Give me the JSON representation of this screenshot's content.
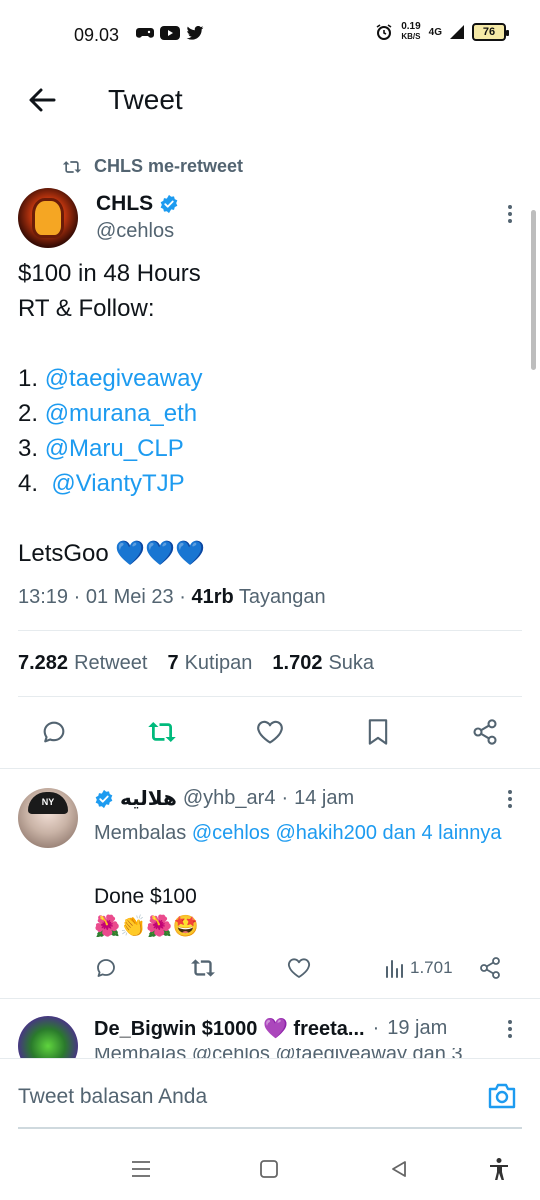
{
  "status_bar": {
    "time": "09.03",
    "speed_value": "0.19",
    "speed_unit": "KB/S",
    "network": "4G",
    "battery": "76"
  },
  "header": {
    "title": "Tweet"
  },
  "tweet": {
    "retweet_context": "CHLS me-retweet",
    "author_name": "CHLS",
    "author_handle": "@cehlos",
    "lines": {
      "l1": "$100 in 48 Hours",
      "l2": "RT & Follow:",
      "n1": "1. ",
      "m1": "@taegiveaway",
      "n2": "2. ",
      "m2": "@murana_eth",
      "n3": "3. ",
      "m3": "@Maru_CLP",
      "n4": "4.  ",
      "m4": "@ViantyTJP",
      "l7": "LetsGoo 💙💙💙"
    },
    "time": "13:19",
    "date": "01 Mei 23",
    "views_count": "41rb",
    "views_label": "Tayangan",
    "stats": {
      "retweet_count": "7.282",
      "retweet_label": "Retweet",
      "quote_count": "7",
      "quote_label": "Kutipan",
      "like_count": "1.702",
      "like_label": "Suka"
    }
  },
  "replies": [
    {
      "name": "هلاليه",
      "handle": "@yhb_ar4",
      "time": "14 jam",
      "replying_prefix": "Membalas ",
      "replying_mentions": "@cehlos @hakih200 dan 4 lainnya",
      "text_line1": "Done $100",
      "text_line2": "🌺👏🌺🤩",
      "views": "1.701"
    },
    {
      "name": "De_Bigwin $1000 💜 freeta...",
      "time": "19 jam",
      "replying_clip": "Membalas @cehlos @taegiveaway dan 3"
    }
  ],
  "compose": {
    "placeholder": "Tweet balasan Anda"
  },
  "colors": {
    "accent": "#1d9bf0",
    "retweet_green": "#00ba7c",
    "text_secondary": "#536471"
  }
}
